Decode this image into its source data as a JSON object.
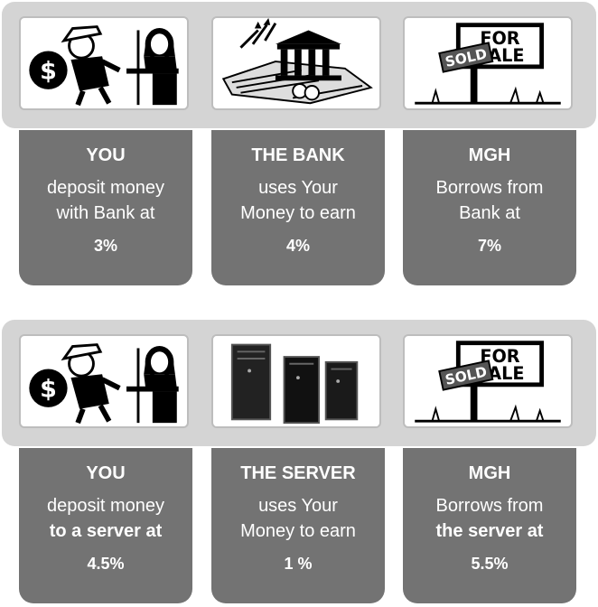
{
  "panels": [
    {
      "cards": [
        {
          "who": "YOU",
          "line1": "deposit money",
          "line2": "with Bank at",
          "line2_bold": false,
          "rate": "3%",
          "icon": "depositor-teller-illustration"
        },
        {
          "who": "THE BANK",
          "line1": "uses Your",
          "line2": "Money to earn",
          "line2_bold": false,
          "rate": "4%",
          "icon": "bank-building-illustration"
        },
        {
          "who": "MGH",
          "line1": "Borrows from",
          "line2": "Bank at",
          "line2_bold": false,
          "rate": "7%",
          "icon": "for-sale-sign-illustration"
        }
      ]
    },
    {
      "cards": [
        {
          "who": "YOU",
          "line1": "deposit money",
          "line2": "to a server at",
          "line2_bold": true,
          "rate": "4.5%",
          "icon": "depositor-teller-illustration"
        },
        {
          "who": "THE SERVER",
          "line1": "uses Your",
          "line2": "Money to earn",
          "line2_bold": false,
          "rate": "1 %",
          "icon": "server-racks-illustration"
        },
        {
          "who": "MGH",
          "line1": "Borrows from",
          "line2": "the server at",
          "line2_bold": true,
          "rate": "5.5%",
          "icon": "for-sale-sign-illustration"
        }
      ]
    }
  ],
  "sign": {
    "top": "FOR",
    "bottom": "SALE",
    "rider": "SOLD"
  }
}
